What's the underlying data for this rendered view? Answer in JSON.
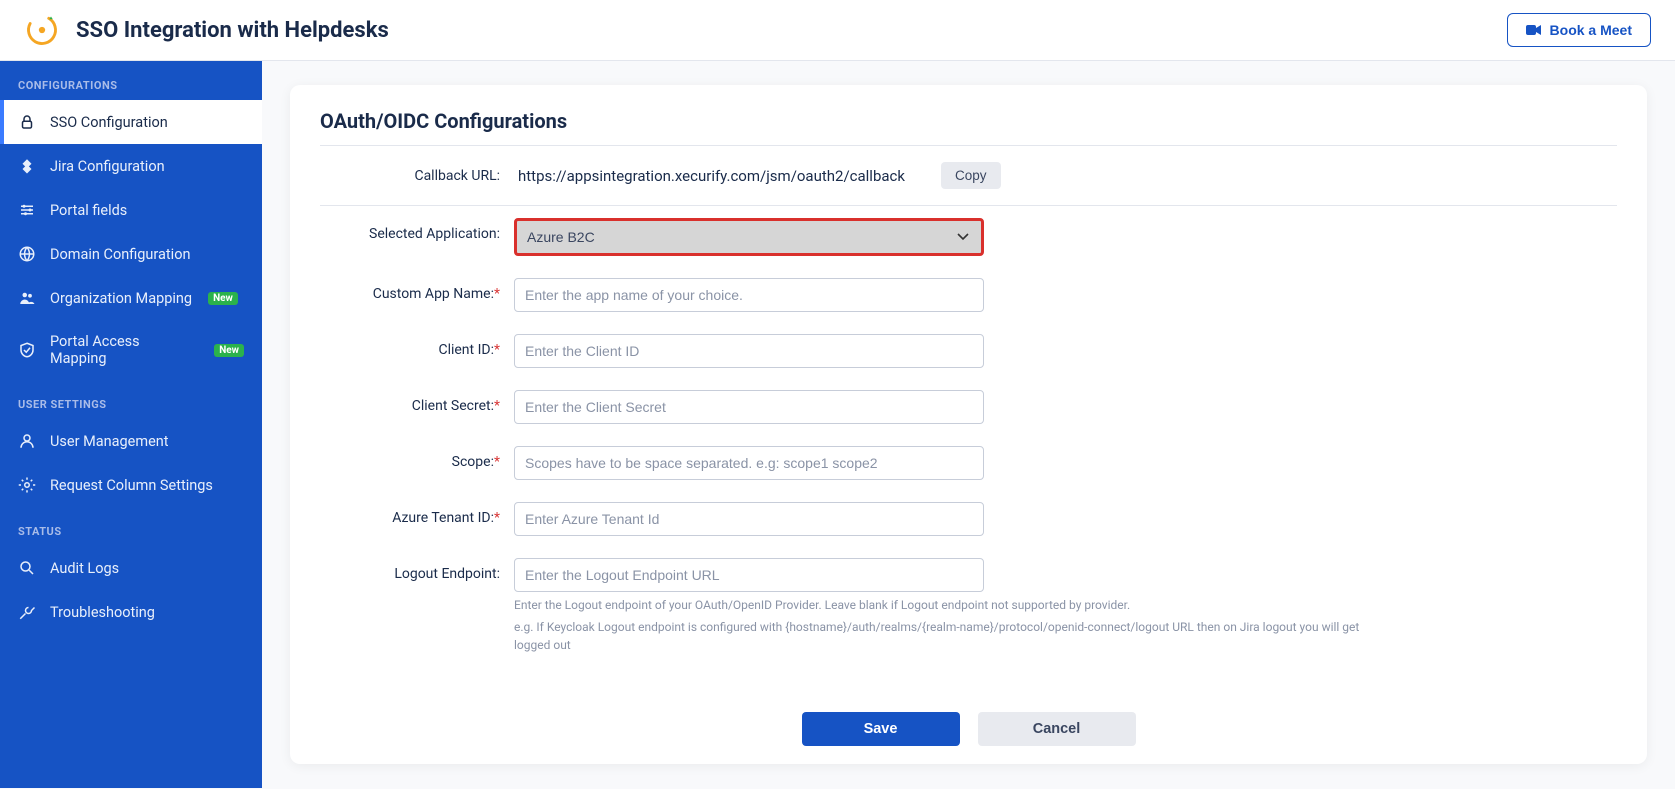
{
  "header": {
    "title": "SSO Integration with Helpdesks",
    "book_meet": "Book a Meet"
  },
  "sidebar": {
    "sections": {
      "configurations": "CONFIGURATIONS",
      "user_settings": "USER SETTINGS",
      "status": "STATUS"
    },
    "items": {
      "sso": "SSO Configuration",
      "jira": "Jira Configuration",
      "portal": "Portal fields",
      "domain": "Domain Configuration",
      "org": "Organization Mapping",
      "portal_access": "Portal Access Mapping",
      "user_mgmt": "User Management",
      "req_col": "Request Column Settings",
      "audit": "Audit Logs",
      "troubleshoot": "Troubleshooting"
    },
    "new_badge": "New"
  },
  "card": {
    "title": "OAuth/OIDC Configurations",
    "callback_label": "Callback URL:",
    "callback_url": "https://appsintegration.xecurify.com/jsm/oauth2/callback",
    "copy": "Copy",
    "fields": {
      "selected_app_label": "Selected Application:",
      "selected_app_value": "Azure B2C",
      "custom_app_label": "Custom App Name:",
      "custom_app_ph": "Enter the app name of your choice.",
      "client_id_label": "Client ID:",
      "client_id_ph": "Enter the Client ID",
      "client_secret_label": "Client Secret:",
      "client_secret_ph": "Enter the Client Secret",
      "scope_label": "Scope:",
      "scope_ph": "Scopes have to be space separated. e.g: scope1 scope2",
      "tenant_label": "Azure Tenant ID:",
      "tenant_ph": "Enter Azure Tenant Id",
      "logout_label": "Logout Endpoint:",
      "logout_ph": "Enter the Logout Endpoint URL",
      "logout_help1": "Enter the Logout endpoint of your OAuth/OpenID Provider. Leave blank if Logout endpoint not supported by provider.",
      "logout_help2": "e.g. If Keycloak Logout endpoint is configured with {hostname}/auth/realms/{realm-name}/protocol/openid-connect/logout URL then on Jira logout you will get logged out"
    },
    "save": "Save",
    "cancel": "Cancel"
  }
}
